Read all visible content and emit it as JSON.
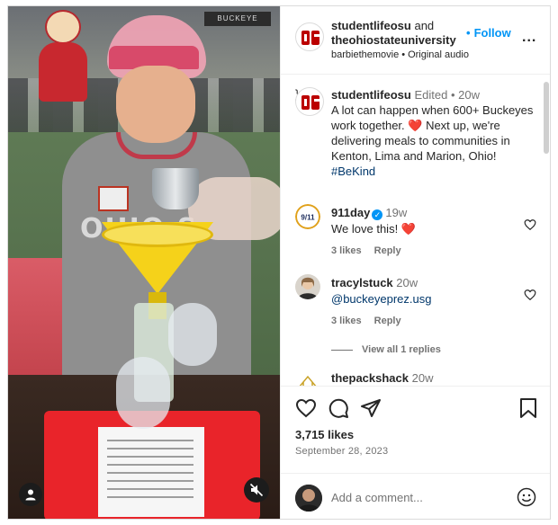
{
  "header": {
    "account_1": "studentlifeosu",
    "and": "and",
    "account_2": "theohiostateuniversity",
    "follow_label": "Follow",
    "audio_1": "barbiethemovie",
    "audio_sep": "•",
    "audio_2": "Original audio",
    "more_label": "..."
  },
  "media": {
    "banner_text": "BUCKEYE",
    "shirt_text": "OHIO S"
  },
  "caption": {
    "username": "studentlifeosu",
    "edited": "Edited",
    "time": "20w",
    "text": "A lot can happen when 600+ Buckeyes work together. ❤️ Next up, we're delivering meals to communities in Kenton, Lima and Marion, Ohio!",
    "hashtag": "#BeKind"
  },
  "comments": [
    {
      "username": "911day",
      "verified": true,
      "time": "19w",
      "avatar_text": "9/11",
      "text": "We love this! ❤️",
      "likes": "3 likes",
      "reply": "Reply"
    },
    {
      "username": "tracylstuck",
      "verified": false,
      "time": "20w",
      "mention": "@buckeyeprez.usg",
      "likes": "3 likes",
      "reply": "Reply"
    },
    {
      "username": "thepackshack",
      "time": "20w"
    }
  ],
  "view_replies": "View all 1 replies",
  "footer": {
    "likes": "3,715 likes",
    "date": "September 28, 2023",
    "add_comment_placeholder": "Add a comment..."
  },
  "colors": {
    "accent": "#0095f6",
    "osu_red": "#bb0000",
    "heart_red": "#ed4956"
  },
  "icons": [
    "heart-icon",
    "comment-icon",
    "share-icon",
    "bookmark-icon",
    "emoji-icon",
    "mute-icon",
    "user-tag-icon",
    "verified-icon",
    "more-icon"
  ]
}
